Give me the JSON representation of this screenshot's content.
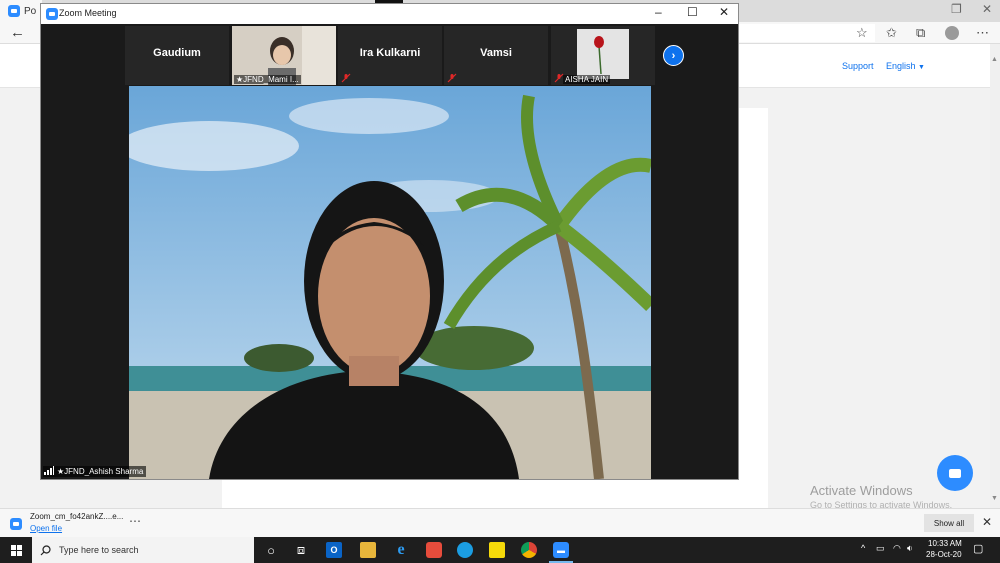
{
  "browser": {
    "tab_title": "Po",
    "support_link": "Support",
    "language_link": "English",
    "activate_title": "Activate Windows",
    "activate_subtitle": "Go to Settings to activate Windows."
  },
  "zoom_window": {
    "title": "Zoom Meeting",
    "participants": [
      {
        "name": "Gaudium",
        "has_video": false
      },
      {
        "name": "★JFND_Mami I...",
        "has_video": true
      },
      {
        "name": "Ira Kulkarni",
        "has_video": false
      },
      {
        "name": "Vamsi",
        "has_video": false
      },
      {
        "name": "AISHA JAIN",
        "has_video": true
      }
    ],
    "active_speaker": "★JFND_Ashish Sharma"
  },
  "download_bar": {
    "file_name": "Zoom_cm_fo42ankZ....e...",
    "open_file": "Open file",
    "show_all": "Show all"
  },
  "taskbar": {
    "search_placeholder": "Type here to search",
    "time": "10:33 AM",
    "date": "28-Oct-20"
  },
  "colors": {
    "zoom_blue": "#2d8cff",
    "link_blue": "#0e72ed",
    "taskbar": "#1e1e1e"
  }
}
